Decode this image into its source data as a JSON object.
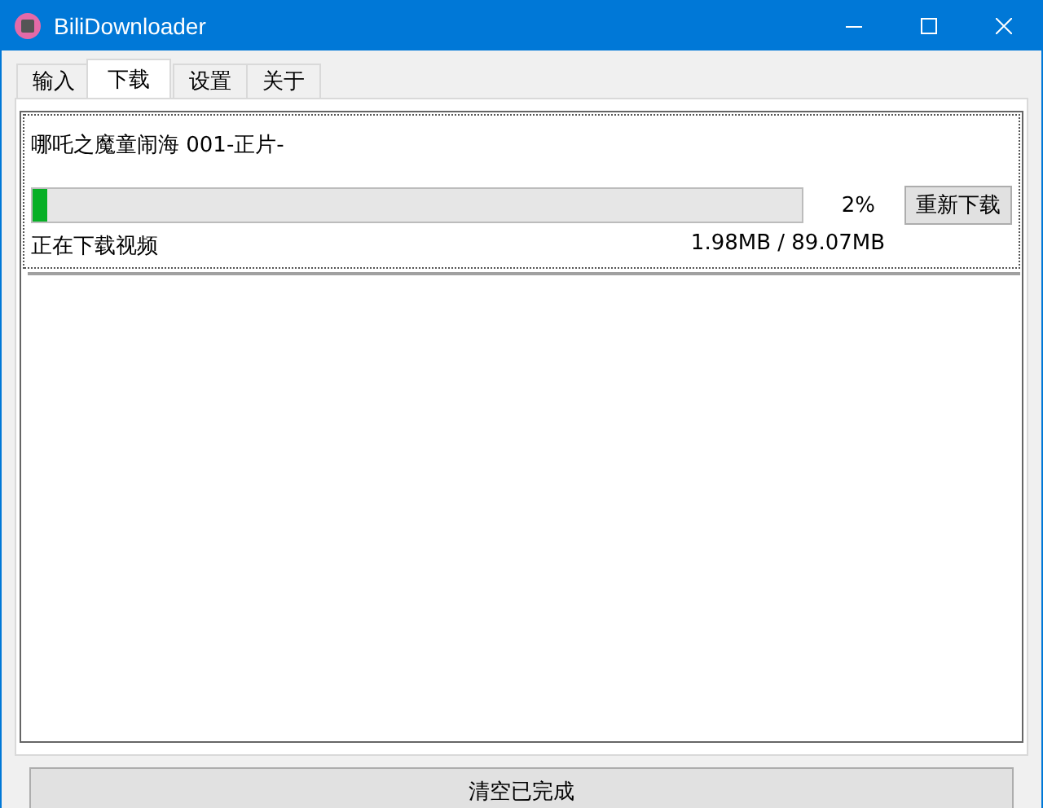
{
  "window": {
    "title": "BiliDownloader"
  },
  "tabs": [
    {
      "label": "输入",
      "selected": false
    },
    {
      "label": "下载",
      "selected": true
    },
    {
      "label": "设置",
      "selected": false
    },
    {
      "label": "关于",
      "selected": false
    }
  ],
  "downloads": [
    {
      "title": "哪吒之魔童闹海 001-正片-",
      "level": 0.02,
      "percent": "2%",
      "action": "重新下载",
      "status": "正在下载视频",
      "size": "1.98MB / 89.07MB"
    }
  ],
  "footer_button": "清空已完成"
}
